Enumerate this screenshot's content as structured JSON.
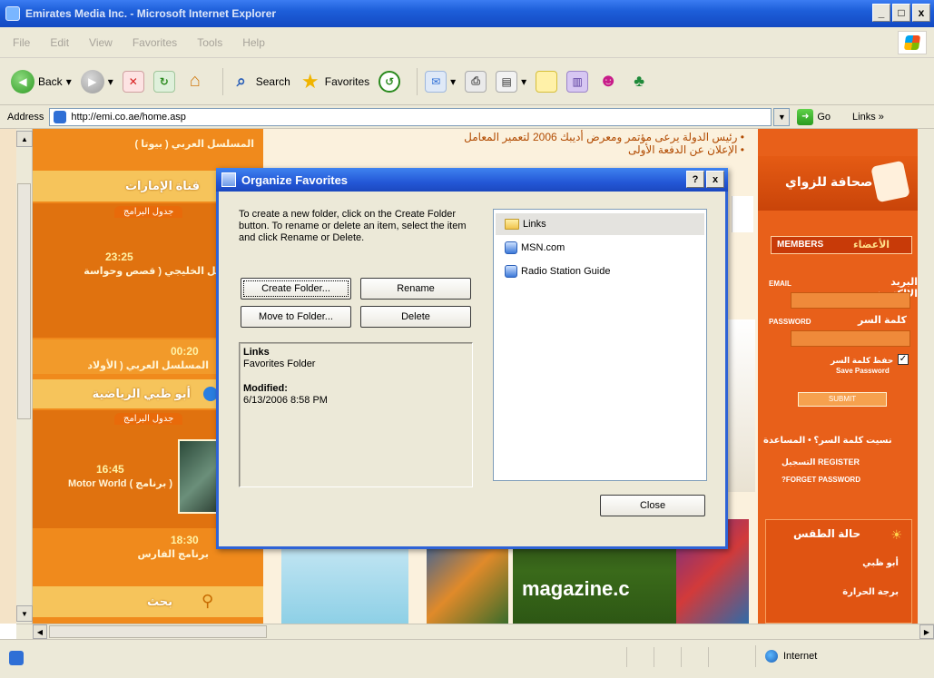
{
  "window": {
    "title": "Emirates Media Inc. - Microsoft Internet Explorer",
    "controls": [
      "_",
      "□",
      "x"
    ]
  },
  "menu": [
    "File",
    "Edit",
    "View",
    "Favorites",
    "Tools",
    "Help"
  ],
  "toolbar": {
    "back": "Back",
    "search": "Search",
    "favorites": "Favorites"
  },
  "address": {
    "label": "Address",
    "url": "http://emi.co.ae/home.asp",
    "go": "Go",
    "links": "Links"
  },
  "page": {
    "left_items": [
      "المسلسل العربي ( بيوتا )",
      "قناة الإمارات",
      "جدول البرامج",
      "23:25",
      "المسلسل الخليجي ( قصص وحواسة",
      "00:20",
      "المسلسل العربي ( الأولاد",
      "أبو ظبي الرياضية",
      "جدول البرامج",
      "16:45",
      "( برنامج ) Motor World",
      "18:30",
      "برنامج الفارس",
      "بحث"
    ],
    "news": [
      "رئيس الدولة يرعى مؤتمر ومعرض أديبك 2006 لتعمير المعامل",
      "الإعلان عن الدفعة الأولى"
    ],
    "right": {
      "title": "صحافة للزواي",
      "members": "MEMBERS",
      "members_ar": "الأعضاء",
      "email": "EMAIL",
      "email_ar": "البريد الإلكتروني",
      "password": "PASSWORD",
      "password_ar": "كلمة السر",
      "remember": "حفظ كلمة السر",
      "remember_en": "Save Password",
      "submit": "SUBMIT",
      "forgot": "نسيت كلمة السر؟ • المساعدة",
      "register": "REGISTER التسجيل",
      "forget": "FORGET PASSWORD?",
      "box_title": "حالة الطقس",
      "box_items": [
        "أبو ظبي",
        "برجة الحرارة"
      ]
    },
    "banner": "magazine.c"
  },
  "dialog": {
    "title": "Organize Favorites",
    "help": "?",
    "close": "x",
    "instructions": "To create a new folder, click on the Create Folder button. To rename or delete an item, select the item and click Rename or Delete.",
    "buttons": {
      "create_folder": "Create Folder...",
      "rename": "Rename",
      "move_to_folder": "Move to Folder...",
      "delete": "Delete",
      "close": "Close"
    },
    "info": {
      "name": "Links",
      "type": "Favorites Folder",
      "modified_label": "Modified:",
      "modified_value": "6/13/2006 8:58 PM"
    },
    "items": [
      {
        "name": "Links",
        "type": "folder"
      },
      {
        "name": "MSN.com",
        "type": "link"
      },
      {
        "name": "Radio Station Guide",
        "type": "link"
      }
    ]
  },
  "status": {
    "zone": "Internet"
  }
}
